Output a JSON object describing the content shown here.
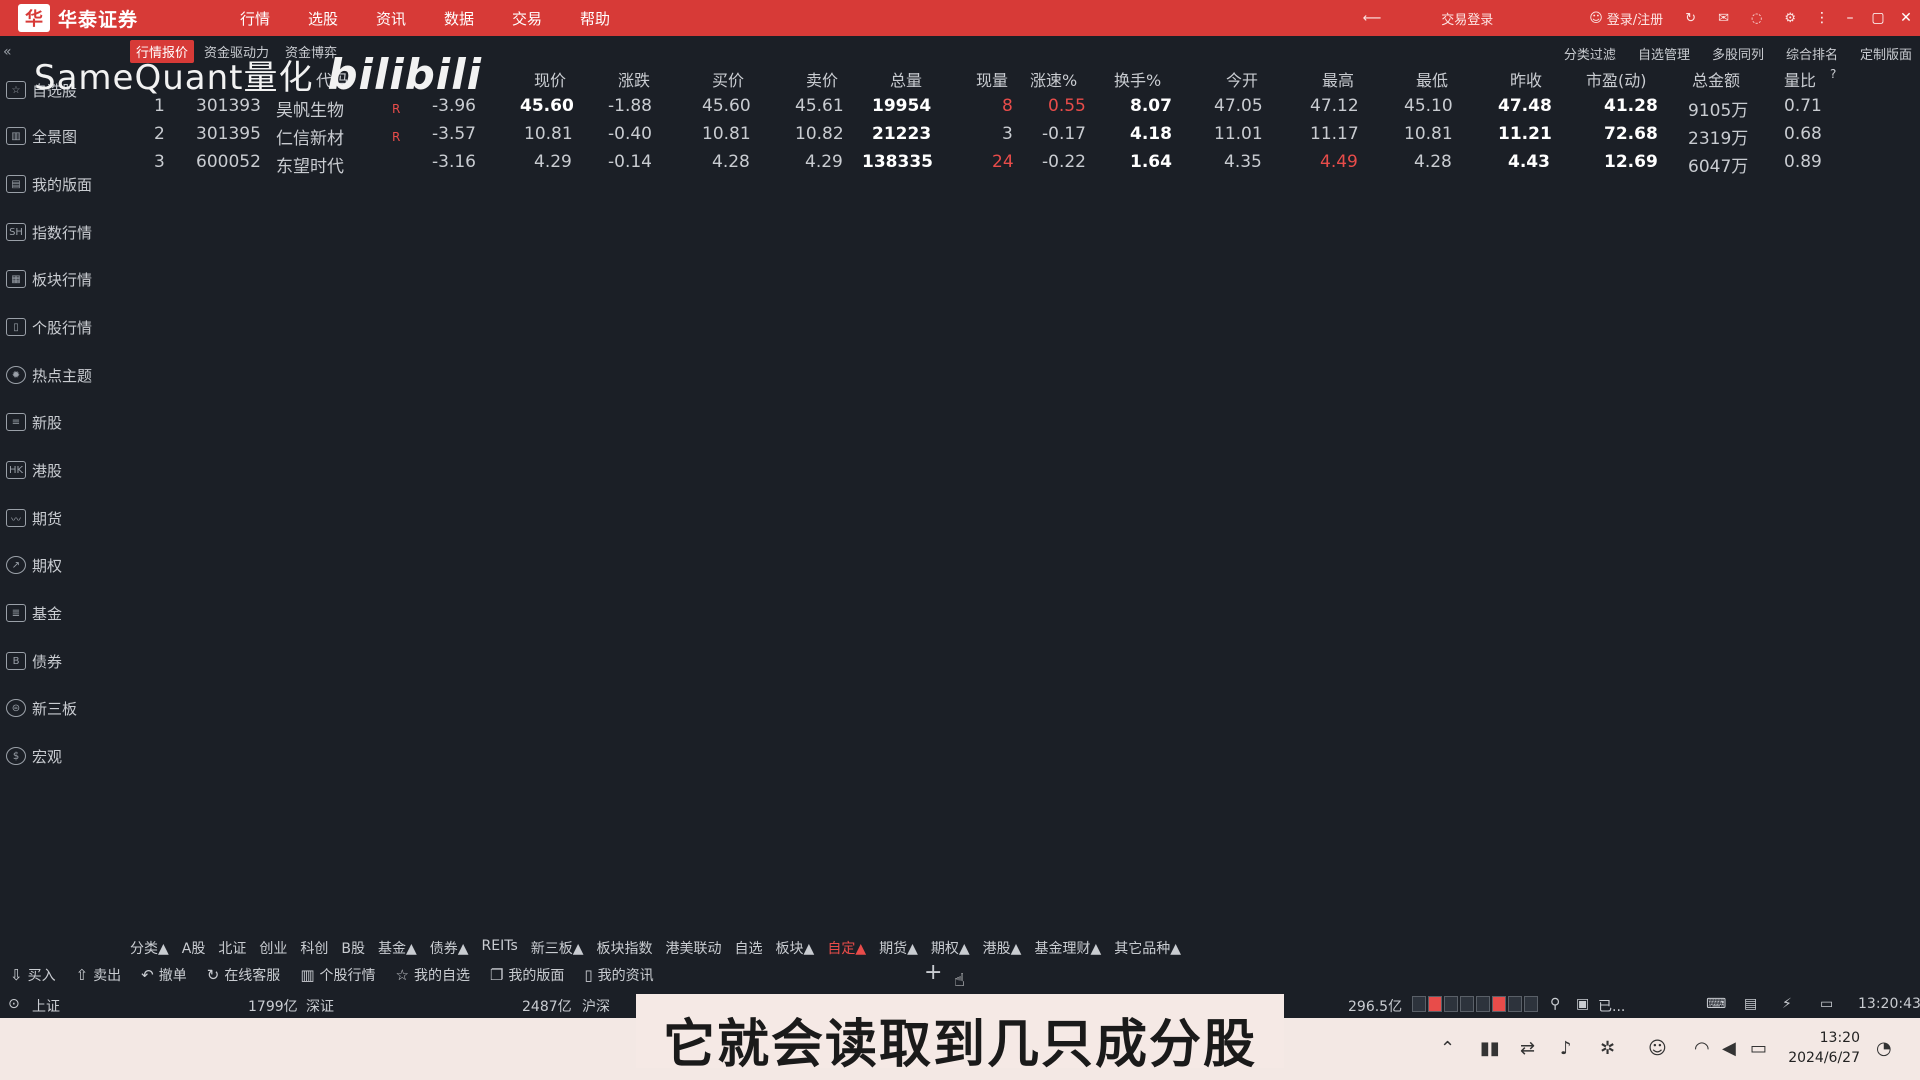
{
  "app": {
    "name": "华泰证券",
    "menu": [
      "行情",
      "选股",
      "资讯",
      "数据",
      "交易",
      "帮助"
    ],
    "trade_login": "交易登录",
    "user": "登录/注册"
  },
  "subtabs": [
    "行情报价",
    "资金驱动力",
    "资金博弈"
  ],
  "subright": [
    "分类过滤",
    "自选管理",
    "多股同列",
    "综合排名",
    "定制版面"
  ],
  "watermark": {
    "text": "SameQuant量化",
    "logo": "bilibili"
  },
  "sidebar": [
    {
      "label": "自选股",
      "icon": "star-icon"
    },
    {
      "label": "全景图",
      "icon": "chart-icon"
    },
    {
      "label": "我的版面",
      "icon": "layout-icon"
    },
    {
      "label": "指数行情",
      "icon": "sh-icon"
    },
    {
      "label": "板块行情",
      "icon": "board-icon"
    },
    {
      "label": "个股行情",
      "icon": "stock-icon"
    },
    {
      "label": "热点主题",
      "icon": "fire-icon"
    },
    {
      "label": "新股",
      "icon": "new-icon"
    },
    {
      "label": "港股",
      "icon": "hk-icon"
    },
    {
      "label": "期货",
      "icon": "futures-icon"
    },
    {
      "label": "期权",
      "icon": "option-icon"
    },
    {
      "label": "基金",
      "icon": "fund-icon"
    },
    {
      "label": "债券",
      "icon": "bond-icon"
    },
    {
      "label": "新三板",
      "icon": "neeq-icon"
    },
    {
      "label": "宏观",
      "icon": "macro-icon"
    }
  ],
  "table": {
    "headers": [
      "代码",
      "现价",
      "涨跌",
      "买价",
      "卖价",
      "总量",
      "现量",
      "涨速%",
      "换手%",
      "今开",
      "最高",
      "最低",
      "昨收",
      "市盈(动)",
      "总金额",
      "量比"
    ],
    "rows": [
      {
        "idx": "1",
        "code": "301393",
        "name": "昊帆生物",
        "flag": "R",
        "chg_pct": "-3.96",
        "price": "45.60",
        "chg": "-1.88",
        "bid": "45.60",
        "ask": "45.61",
        "vol": "19954",
        "cur_vol": "8",
        "speed": "0.55",
        "turnover": "8.07",
        "open": "47.05",
        "high": "47.12",
        "low": "45.10",
        "prev": "47.48",
        "pe": "41.28",
        "amount": "9105万",
        "vol_ratio": "0.71"
      },
      {
        "idx": "2",
        "code": "301395",
        "name": "仁信新材",
        "flag": "R",
        "chg_pct": "-3.57",
        "price": "10.81",
        "chg": "-0.40",
        "bid": "10.81",
        "ask": "10.82",
        "vol": "21223",
        "cur_vol": "3",
        "speed": "-0.17",
        "turnover": "4.18",
        "open": "11.01",
        "high": "11.17",
        "low": "10.81",
        "prev": "11.21",
        "pe": "72.68",
        "amount": "2319万",
        "vol_ratio": "0.68"
      },
      {
        "idx": "3",
        "code": "600052",
        "name": "东望时代",
        "flag": "",
        "chg_pct": "-3.16",
        "price": "4.29",
        "chg": "-0.14",
        "bid": "4.28",
        "ask": "4.29",
        "vol": "138335",
        "cur_vol": "24",
        "speed": "-0.22",
        "turnover": "1.64",
        "open": "4.35",
        "high": "4.49",
        "low": "4.28",
        "prev": "4.43",
        "pe": "12.69",
        "amount": "6047万",
        "vol_ratio": "0.89"
      }
    ]
  },
  "bottom_tabs": [
    "分类▲",
    "A股",
    "北证",
    "创业",
    "科创",
    "B股",
    "基金▲",
    "债券▲",
    "REITs",
    "新三板▲",
    "板块指数",
    "港美联动",
    "自选",
    "板块▲",
    "自定▲",
    "期货▲",
    "期权▲",
    "港股▲",
    "基金理财▲",
    "其它品种▲"
  ],
  "toolbar": [
    "买入",
    "卖出",
    "撤单",
    "在线客服",
    "个股行情",
    "我的自选",
    "我的版面",
    "我的资讯"
  ],
  "status": {
    "index_name": "上证",
    "sh_amount": "1799亿",
    "sz_label": "深证",
    "sz_amount": "2487亿",
    "hs_label": "沪深",
    "north": "296.5亿",
    "tail": "已...",
    "time": "13:20:43"
  },
  "subtitle": "它就会读取到几只成分股",
  "taskbar": {
    "time": "13:20",
    "date": "2024/6/27"
  }
}
